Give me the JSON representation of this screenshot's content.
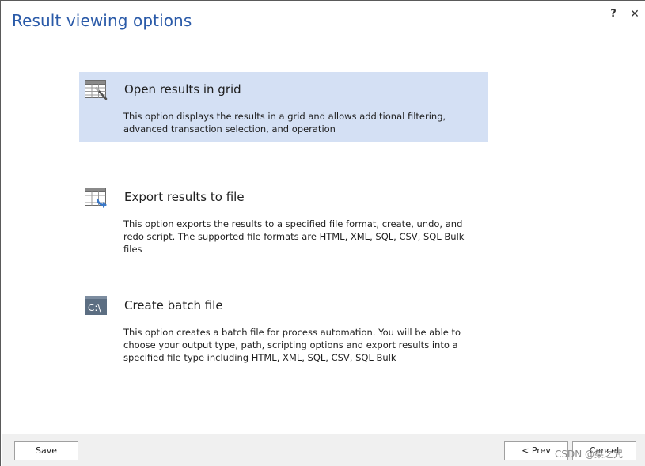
{
  "dialog": {
    "title": "Result viewing options",
    "help_label": "?",
    "close_label": "✕"
  },
  "options": [
    {
      "title": "Open results in grid",
      "description": "This option displays the results in a grid and allows additional filtering, advanced transaction selection, and operation",
      "icon": "grid-icon",
      "selected": true
    },
    {
      "title": "Export results to file",
      "description": "This option exports the results to a specified file format, create, undo, and redo script. The supported file formats are HTML, XML, SQL, CSV, SQL Bulk files",
      "icon": "export-file-icon",
      "selected": false
    },
    {
      "title": "Create batch file",
      "description": "This option creates a batch file for process automation. You will be able to choose your output type, path, scripting options and export results into a specified file type including HTML, XML, SQL, CSV, SQL Bulk",
      "icon": "batch-file-icon",
      "icon_text": "C:\\",
      "selected": false
    }
  ],
  "footer": {
    "save_label": "Save",
    "prev_label": "< Prev",
    "cancel_label": "Cancel"
  },
  "watermark": "CSDN @桀之咒",
  "colors": {
    "title": "#2a5aa8",
    "selected_bg": "#d4e0f4",
    "footer_bg": "#f0f0f0",
    "icon_blue": "#3a78c8",
    "batch_icon_bg": "#5c6e82"
  }
}
